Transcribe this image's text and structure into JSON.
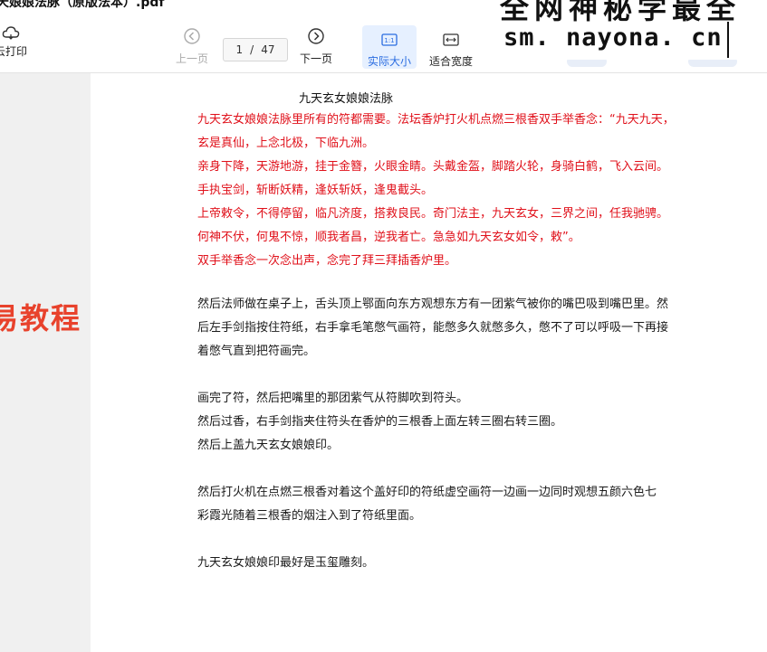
{
  "window": {
    "title": "天娘娘法脉（原版法本）.pdf"
  },
  "toolbar": {
    "cloud_print_label": "云打印",
    "prev_label": "上一页",
    "next_label": "下一页",
    "page_current": "1",
    "page_separator": "/",
    "page_total": "47",
    "actual_size_label": "实际大小",
    "fit_width_label": "适合宽度"
  },
  "watermark": {
    "top_text": "全网神秘学最全",
    "domain": "sm. nayona. cn"
  },
  "sidebar": {
    "promo_text": "易教程"
  },
  "document": {
    "title": "九天玄女娘娘法脉",
    "red_lines": [
      "九天玄女娘娘法脉里所有的符都需要。法坛香炉打火机点燃三根香双手举香念：“九天九天，",
      "玄是真仙，上念北极，下临九洲。",
      "亲身下降，天游地游，挂于金簪，火眼金睛。头戴金盔，脚踏火轮，身骑白鹤，飞入云间。",
      "手执宝剑，斩断妖精，逢妖斩妖，逢鬼截头。",
      "上帝敕令，不得停留，临凡济度，搭救良民。奇门法主，九天玄女，三界之间，任我驰骋。",
      "何神不伏，何鬼不惊，顺我者昌，逆我者亡。急急如九天玄女如令，敕”。",
      "双手举香念一次念出声，念完了拜三拜插香炉里。"
    ],
    "para1_lines": [
      "然后法师做在桌子上，舌头顶上鄂面向东方观想东方有一团紫气被你的嘴巴吸到嘴巴里。然",
      "后左手剑指按住符纸，右手拿毛笔憋气画符，能憋多久就憋多久，憋不了可以呼吸一下再接",
      "着憋气直到把符画完。"
    ],
    "para2_lines": [
      "画完了符，然后把嘴里的那团紫气从符脚吹到符头。",
      "然后过香，右手剑指夹住符头在香炉的三根香上面左转三圈右转三圈。",
      "然后上盖九天玄女娘娘印。"
    ],
    "para3_lines": [
      "然后打火机在点燃三根香对着这个盖好印的符纸虚空画符一边画一边同时观想五颜六色七",
      "彩霞光随着三根香的烟注入到了符纸里面。"
    ],
    "para4_lines": [
      "九天玄女娘娘印最好是玉玺雕刻。"
    ]
  }
}
